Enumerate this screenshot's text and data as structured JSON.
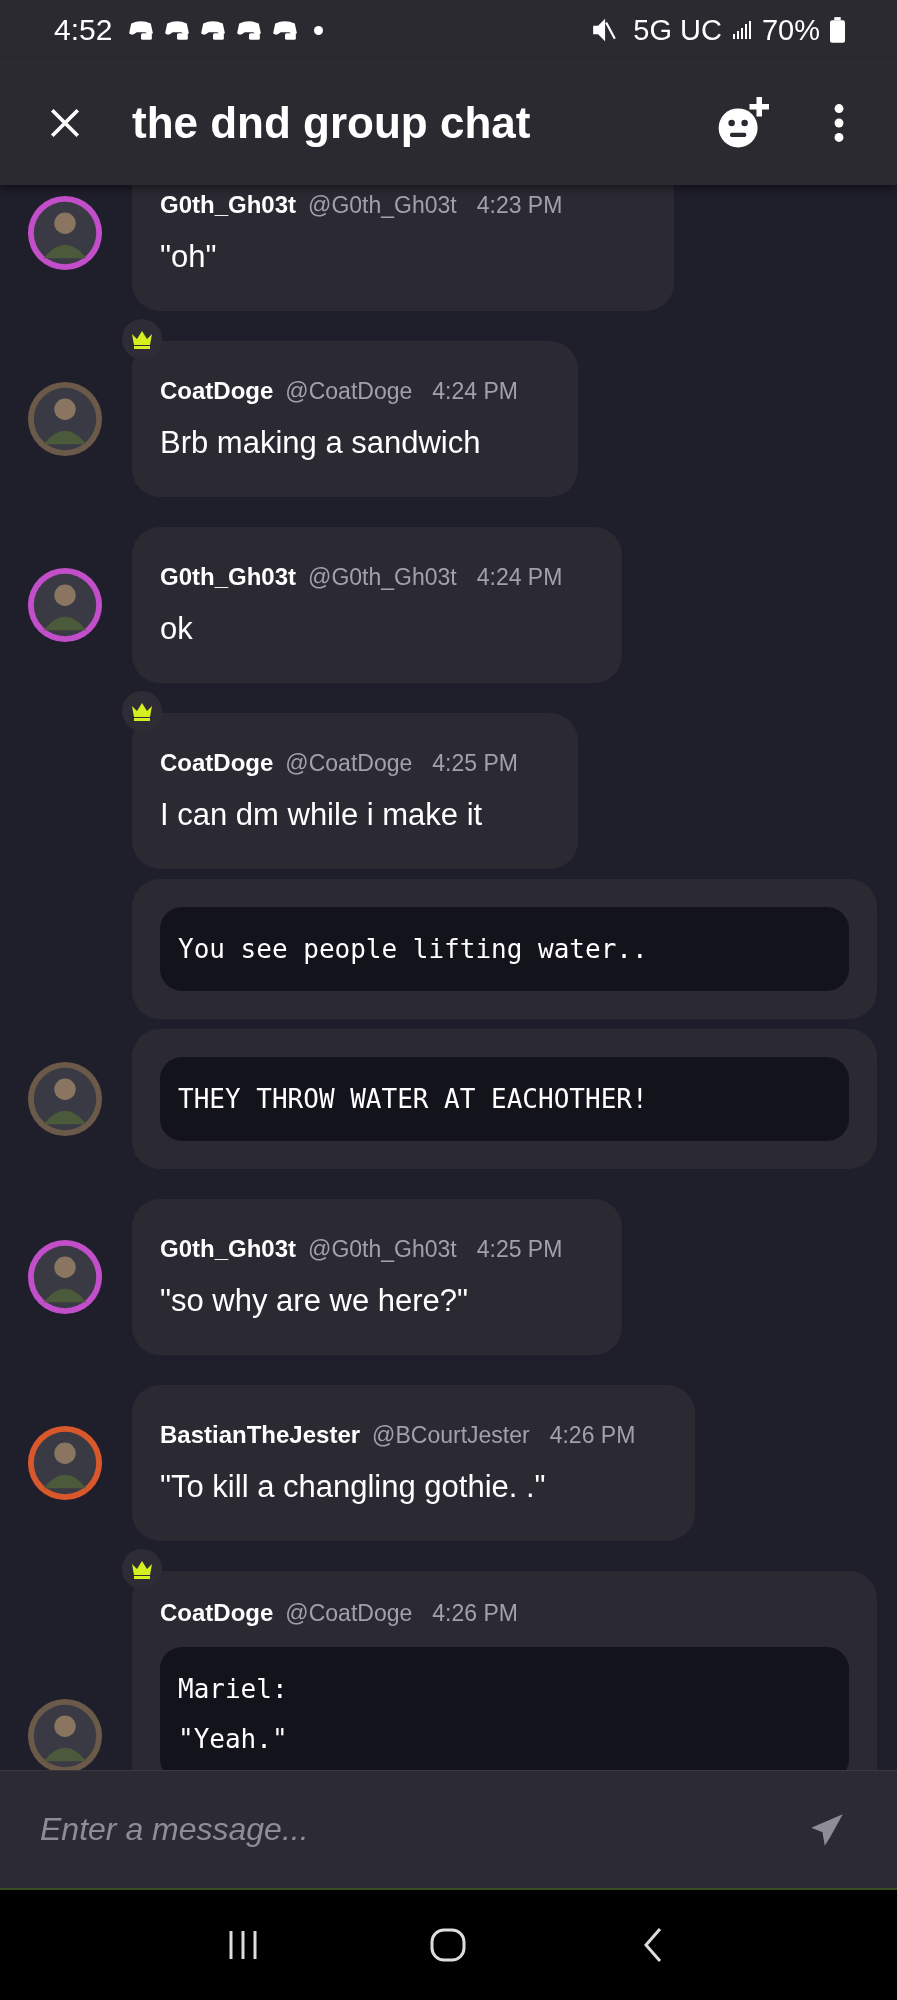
{
  "status_bar": {
    "time": "4:52",
    "network": "5G UC",
    "battery": "70%"
  },
  "header": {
    "title": "the dnd group chat"
  },
  "messages": [
    {
      "author": "G0th_Gh03t",
      "handle": "@G0th_Gh03t",
      "time": "4:23 PM",
      "crown": false,
      "avatar": true,
      "color": "#c24fc9",
      "body": [
        {
          "kind": "text",
          "text": "\"oh\""
        }
      ]
    },
    {
      "author": "CoatDoge",
      "handle": "@CoatDoge",
      "time": "4:24 PM",
      "crown": true,
      "avatar": true,
      "body": [
        {
          "kind": "text",
          "text": "Brb making a sandwich"
        }
      ]
    },
    {
      "author": "G0th_Gh03t",
      "handle": "@G0th_Gh03t",
      "time": "4:24 PM",
      "crown": false,
      "avatar": true,
      "color": "#c24fc9",
      "body": [
        {
          "kind": "text",
          "text": "ok"
        }
      ]
    },
    {
      "author": "CoatDoge",
      "handle": "@CoatDoge",
      "time": "4:25 PM",
      "crown": true,
      "avatar": false,
      "body": [
        {
          "kind": "text",
          "text": "I can dm while i make it"
        }
      ]
    },
    {
      "crown": false,
      "avatar": false,
      "body": [
        {
          "kind": "code",
          "lines": [
            "You see people lifting water.."
          ]
        }
      ]
    },
    {
      "crown": false,
      "avatar": true,
      "body": [
        {
          "kind": "code",
          "lines": [
            "THEY THROW WATER AT EACHOTHER!"
          ]
        }
      ]
    },
    {
      "author": "G0th_Gh03t",
      "handle": "@G0th_Gh03t",
      "time": "4:25 PM",
      "crown": false,
      "avatar": true,
      "color": "#c24fc9",
      "body": [
        {
          "kind": "text",
          "text": "\"so why are we here?\""
        }
      ]
    },
    {
      "author": "BastianTheJester",
      "handle": "@BCourtJester",
      "time": "4:26 PM",
      "crown": false,
      "avatar": true,
      "color": "#d9582b",
      "body": [
        {
          "kind": "text",
          "text": "\"To kill a changling gothie. .\""
        }
      ]
    },
    {
      "author": "CoatDoge",
      "handle": "@CoatDoge",
      "time": "4:26 PM",
      "crown": true,
      "avatar": true,
      "body": [
        {
          "kind": "code",
          "lines": [
            "Mariel:",
            "\"Yeah.\""
          ]
        }
      ]
    }
  ],
  "composer": {
    "placeholder": "Enter a message..."
  }
}
